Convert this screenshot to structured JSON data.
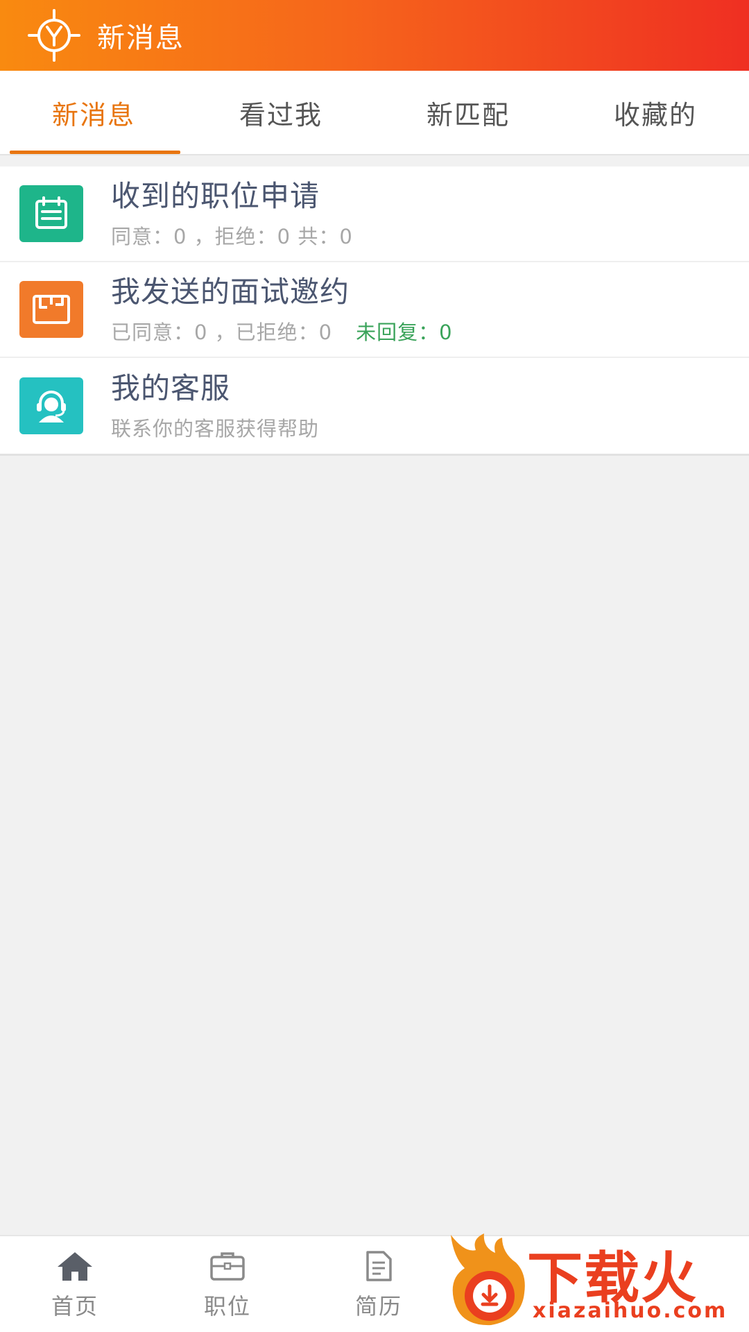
{
  "header": {
    "title": "新消息",
    "logo_icon": "target-y-logo-icon"
  },
  "tabs": [
    {
      "label": "新消息",
      "active": true
    },
    {
      "label": "看过我",
      "active": false
    },
    {
      "label": "新匹配",
      "active": false
    },
    {
      "label": "收藏的",
      "active": false
    }
  ],
  "list": [
    {
      "title": "收到的职位申请",
      "subtitle": "同意：0 ，拒绝：0 共：0",
      "icon": "calendar-icon",
      "color": "#1eb58a"
    },
    {
      "title": "我发送的面试邀约",
      "subtitle": "已同意：0 ，已拒绝：0",
      "pending": "未回复：0",
      "icon": "store-icon",
      "color": "#f17a2a"
    },
    {
      "title": "我的客服",
      "subtitle": "联系你的客服获得帮助",
      "icon": "customer-service-icon",
      "color": "#25c1c1"
    }
  ],
  "bottom_nav": [
    {
      "label": "首页",
      "icon": "home-icon"
    },
    {
      "label": "职位",
      "icon": "briefcase-icon"
    },
    {
      "label": "简历",
      "icon": "document-icon"
    }
  ],
  "watermark": {
    "text": "下载火",
    "url": "xiazaihuo.com"
  },
  "colors": {
    "accent": "#e8750e",
    "header_start": "#f98a10",
    "header_end": "#ef2f22",
    "pending": "#3aa35a"
  }
}
